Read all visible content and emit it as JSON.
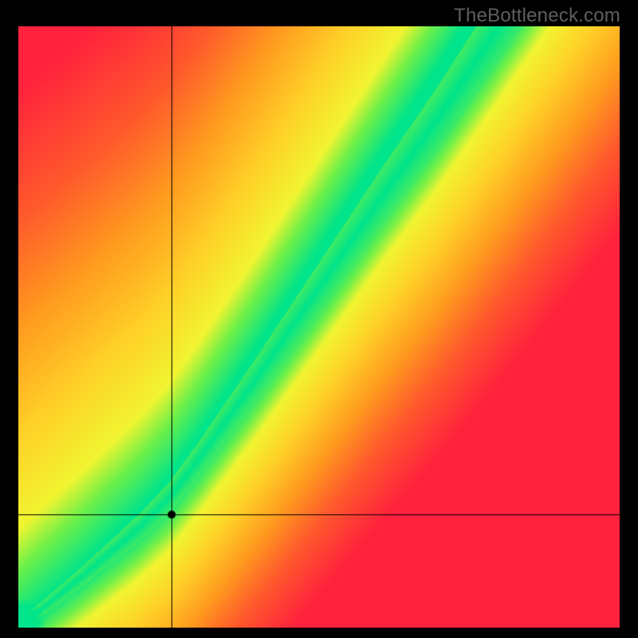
{
  "watermark": "TheBottleneck.com",
  "chart_data": {
    "type": "heatmap",
    "title": "",
    "xlabel": "",
    "ylabel": "",
    "xlim": [
      0,
      1
    ],
    "ylim": [
      0,
      1
    ],
    "crosshair": {
      "x": 0.255,
      "y": 0.188
    },
    "marker": {
      "x": 0.255,
      "y": 0.188
    },
    "ridge_curve_comment": "piecewise-linear approximation of the green band centerline (optimal GPU for given CPU); x,y in [0,1], origin bottom-left",
    "ridge_curve": [
      {
        "x": 0.0,
        "y": 0.0
      },
      {
        "x": 0.1,
        "y": 0.08
      },
      {
        "x": 0.2,
        "y": 0.165
      },
      {
        "x": 0.25,
        "y": 0.215
      },
      {
        "x": 0.3,
        "y": 0.28
      },
      {
        "x": 0.4,
        "y": 0.42
      },
      {
        "x": 0.5,
        "y": 0.565
      },
      {
        "x": 0.6,
        "y": 0.71
      },
      {
        "x": 0.7,
        "y": 0.85
      },
      {
        "x": 0.8,
        "y": 1.0
      }
    ],
    "green_band_halfwidth_start": 0.01,
    "green_band_halfwidth_end": 0.06,
    "color_stops_comment": "map from |y - ridge(x)| * falloff → color; 0 = on ridge",
    "color_stops": [
      {
        "t": 0.0,
        "color": "#00e48b"
      },
      {
        "t": 0.1,
        "color": "#6cf04a"
      },
      {
        "t": 0.18,
        "color": "#f2f531"
      },
      {
        "t": 0.35,
        "color": "#ffd128"
      },
      {
        "t": 0.55,
        "color": "#ff9b1f"
      },
      {
        "t": 0.75,
        "color": "#ff5a2c"
      },
      {
        "t": 1.0,
        "color": "#ff213e"
      }
    ]
  }
}
